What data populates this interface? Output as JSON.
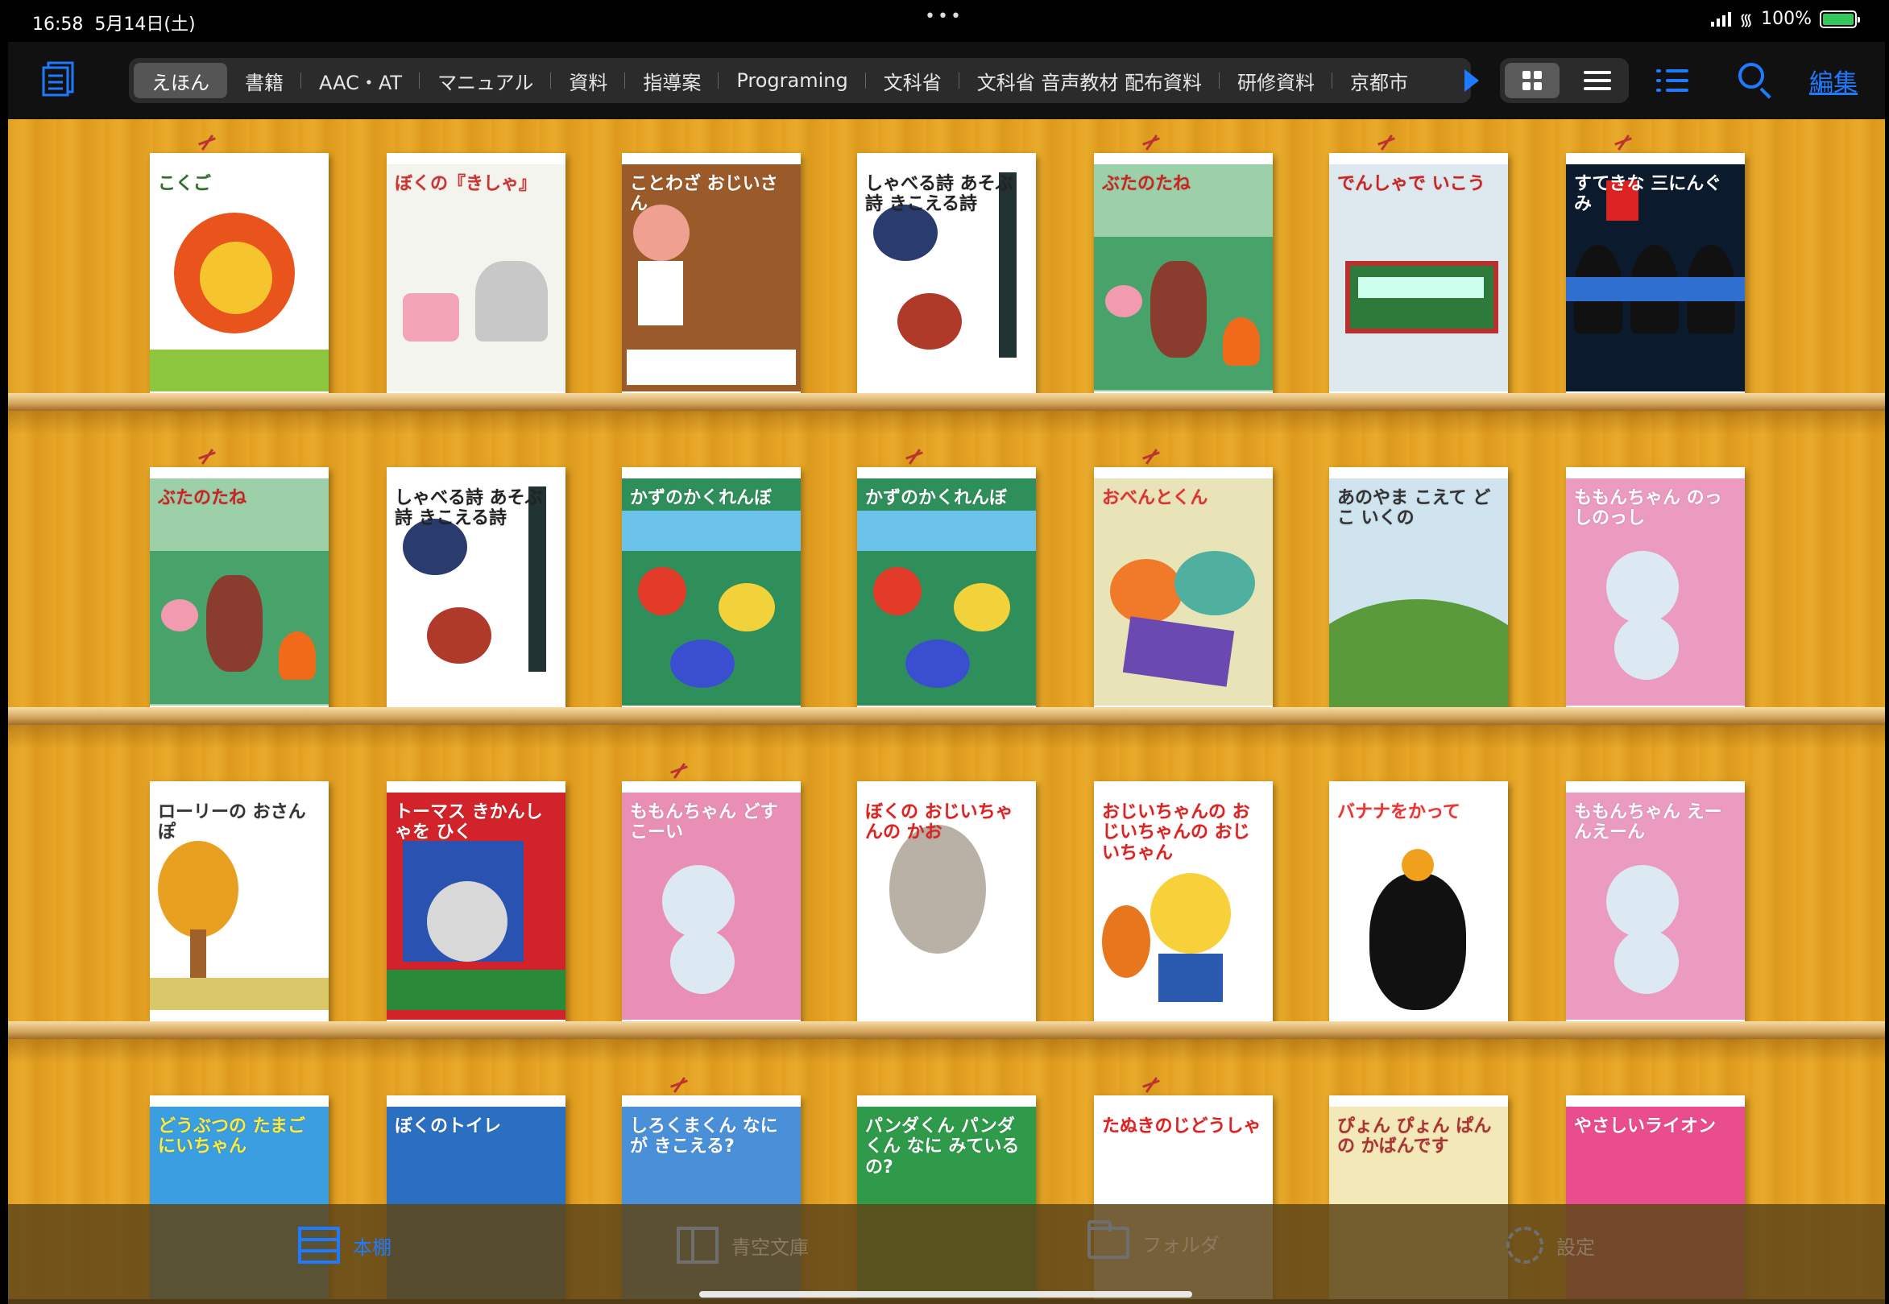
{
  "status_bar": {
    "time": "16:58",
    "date": "5月14日(土)",
    "battery": "100%",
    "battery_level": 1.0
  },
  "nav": {
    "tabs": [
      {
        "label": "えほん",
        "active": true
      },
      {
        "label": "書籍"
      },
      {
        "label": "AAC・AT"
      },
      {
        "label": "マニュアル"
      },
      {
        "label": "資料"
      },
      {
        "label": "指導案"
      },
      {
        "label": "Programing"
      },
      {
        "label": "文科省"
      },
      {
        "label": "文科省 音声教材 配布資料"
      },
      {
        "label": "研修資料"
      },
      {
        "label": "京都市"
      }
    ],
    "edit_label": "編集",
    "accent": "#1e7bff"
  },
  "shelves": [
    {
      "books": [
        {
          "title": "こくご"
        },
        {
          "title": "ぼくの『きしゃ』"
        },
        {
          "title": "ことわざ おじいさん"
        },
        {
          "title": "しゃべる詩 あそぶ詩 きこえる詩"
        },
        {
          "title": "ぶたのたね"
        },
        {
          "title": "でんしゃで いこう"
        },
        {
          "title": "すてきな 三にんぐみ"
        }
      ]
    },
    {
      "books": [
        {
          "title": "ぶたのたね"
        },
        {
          "title": "しゃべる詩 あそぶ詩 きこえる詩"
        },
        {
          "title": "かずのかくれんぼ"
        },
        {
          "title": "かずのかくれんぼ"
        },
        {
          "title": "おべんとくん"
        },
        {
          "title": "あのやま こえて どこ いくの"
        },
        {
          "title": "ももんちゃん のっしのっし"
        }
      ]
    },
    {
      "books": [
        {
          "title": "ローリーの おさんぽ"
        },
        {
          "title": "トーマス きかんしゃを ひく"
        },
        {
          "title": "ももんちゃん どすこーい"
        },
        {
          "title": "ぼくの おじいちゃんの かお"
        },
        {
          "title": "おじいちゃんの おじいちゃんの おじいちゃん"
        },
        {
          "title": "バナナをかって"
        },
        {
          "title": "ももんちゃん えーんえーん"
        }
      ]
    },
    {
      "books": [
        {
          "title": "どうぶつの たまごにいちゃん"
        },
        {
          "title": "ぼくのトイレ"
        },
        {
          "title": "しろくまくん なにが きこえる?"
        },
        {
          "title": "パンダくん パンダくん なに みているの?"
        },
        {
          "title": "たぬきのじどうしゃ"
        },
        {
          "title": "ぴょん ぴょん ぱんの かばんです"
        },
        {
          "title": "やさしいライオン"
        }
      ]
    }
  ],
  "tab_bar": {
    "items": [
      {
        "label": "本棚",
        "active": true
      },
      {
        "label": "青空文庫"
      },
      {
        "label": "フォルダ"
      },
      {
        "label": "設定"
      }
    ]
  }
}
